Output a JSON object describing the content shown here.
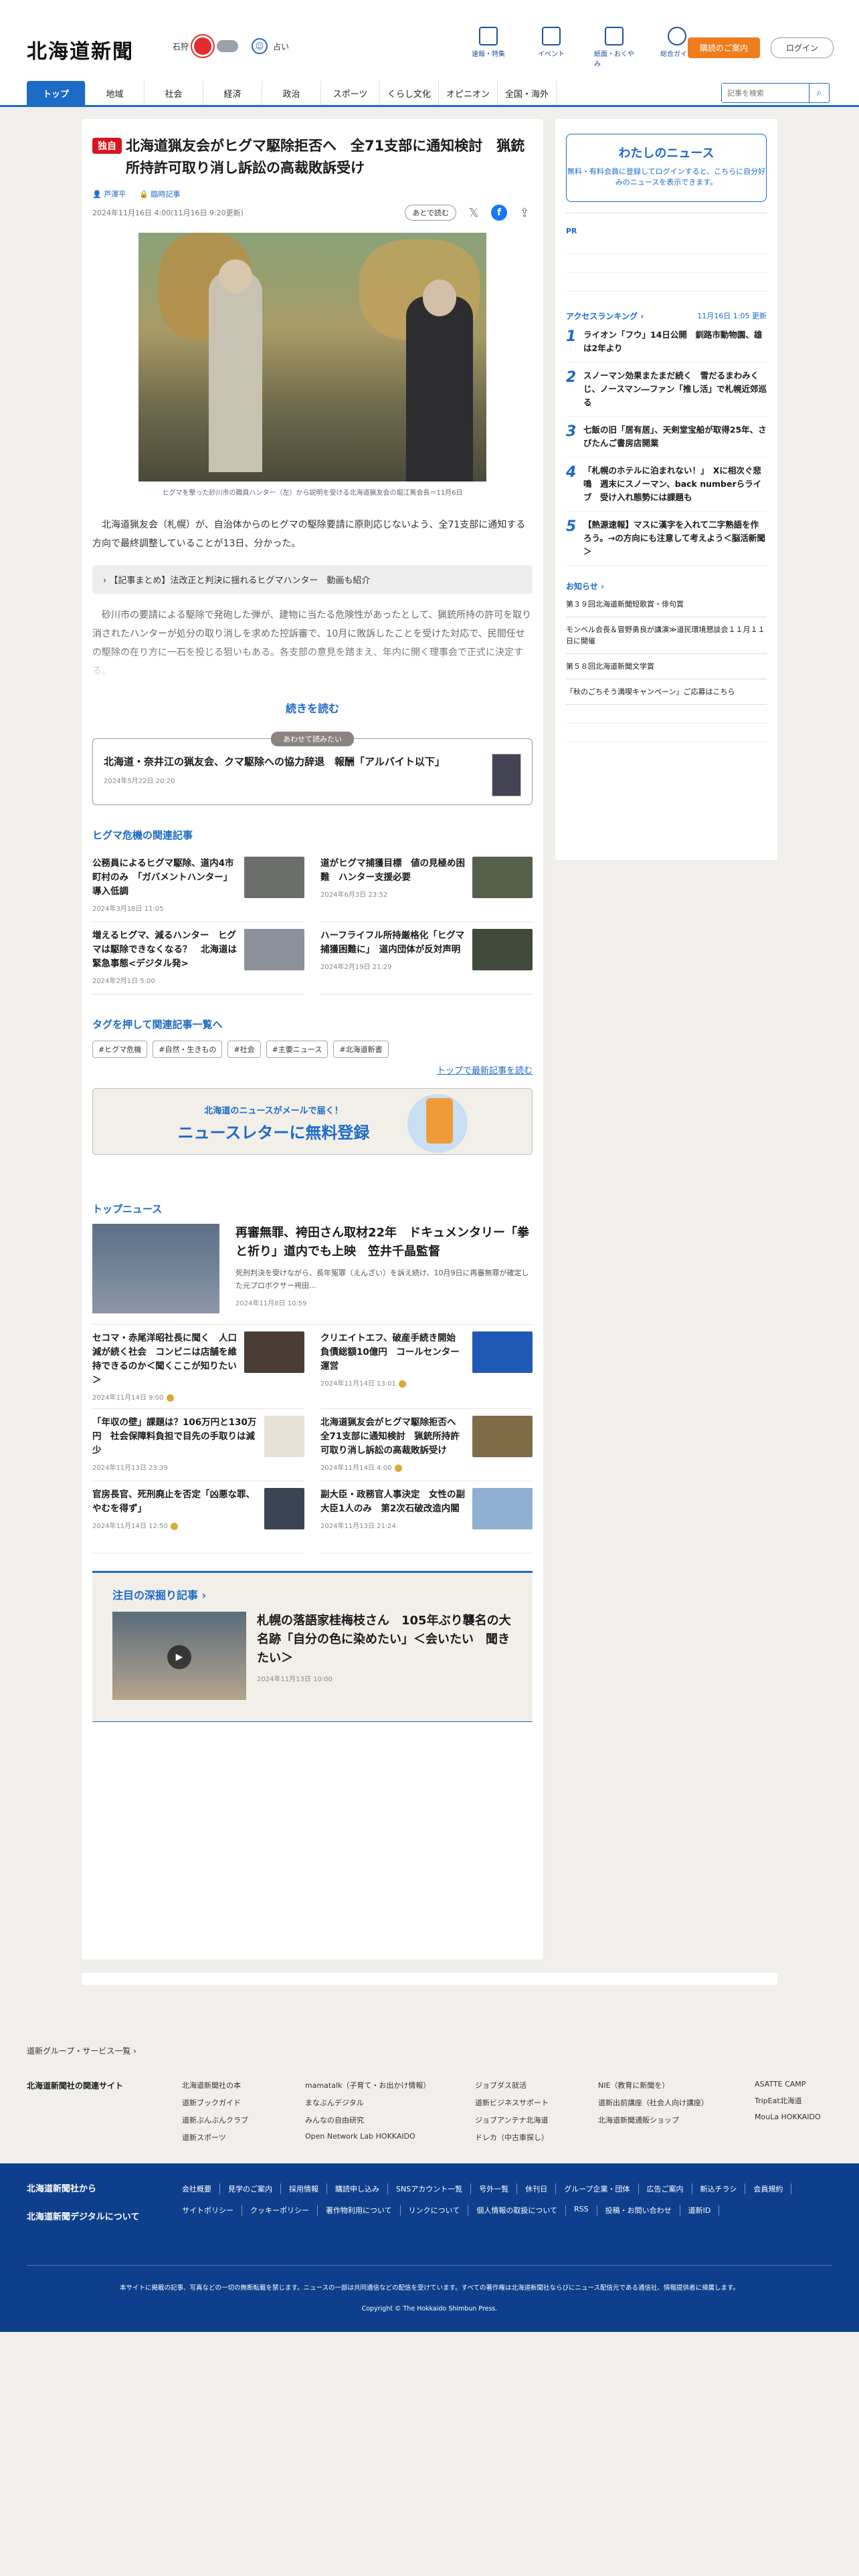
{
  "header": {
    "logo": "北海道新聞",
    "weather_region": "石狩",
    "weather_mood": "占い",
    "icons": [
      {
        "label": "速報・特集",
        "icon": "flag-icon"
      },
      {
        "label": "イベント",
        "icon": "calendar-icon"
      },
      {
        "label": "紙面・おくやみ",
        "icon": "newspaper-icon"
      },
      {
        "label": "総合ガイド",
        "icon": "help-icon"
      }
    ],
    "buy_label": "購読のご案内",
    "login_label": "ログイン"
  },
  "nav": {
    "items": [
      "トップ",
      "地域",
      "社会",
      "経済",
      "政治",
      "スポーツ",
      "くらし文化",
      "オピニオン",
      "全国・海外"
    ],
    "search_placeholder": "記事を検索"
  },
  "article": {
    "badge": "独自",
    "title": "北海道猟友会がヒグマ駆除拒否へ　全71支部に通知検討　猟銃所持許可取り消し訴訟の高裁敗訴受け",
    "author": "芦澤平",
    "category": "臨時記事",
    "date": "2024年11月16日 4:00(11月16日 9:20更新)",
    "save_label": "あとで読む",
    "caption": "ヒグマを撃った砂川市の職員ハンター（左）から説明を受ける北海道猟友会の堀江篤会長＝11月6日",
    "lead": "北海道猟友会（札幌）が、自治体からのヒグマの駆除要請に原則応じないよう、全71支部に通知する方向で最終調整していることが13日、分かった。",
    "related_box": "【記事まとめ】法改正と判決に揺れるヒグマハンター　動画も紹介",
    "body": "砂川市の要請による駆除で発砲した弾が、建物に当たる危険性があったとして、猟銃所持の許可を取り消されたハンターが処分の取り消しを求めた控訴審で、10月に敗訴したことを受けた対応で、民間任せの駆除の在り方に一石を投じる狙いもある。各支部の意見を踏まえ、年内に開く理事会で正式に決定する。",
    "read_more": "続きを読む"
  },
  "also_read": {
    "tag": "あわせて読みたい",
    "title": "北海道・奈井江の猟友会、クマ駆除への協力辞退　報酬「アルバイト以下」",
    "date": "2024年5月22日 20:20"
  },
  "related": {
    "title": "ヒグマ危機の関連記事",
    "items": [
      {
        "title": "公務員によるヒグマ駆除、道内4市町村のみ　「ガバメントハンター」導入低調",
        "date": "2024年3月18日 11:05"
      },
      {
        "title": "道がヒグマ捕獲目標　値の見極め困難　ハンター支援必要",
        "date": "2024年6月3日 23:52"
      },
      {
        "title": "増えるヒグマ、減るハンター　ヒグマは駆除できなくなる？　北海道は緊急事態<デジタル発>",
        "date": "2024年2月1日 5:00"
      },
      {
        "title": "ハーフライフル所持厳格化「ヒグマ捕獲困難に」　道内団体が反対声明",
        "date": "2024年2月19日 21:29"
      }
    ]
  },
  "tags": {
    "title": "タグを押して関連記事一覧へ",
    "items": [
      "#ヒグマ危機",
      "#自然・生きもの",
      "#社会",
      "#主要ニュース",
      "#北海道新書"
    ],
    "more": "トップで最新記事を読む"
  },
  "newsletter": {
    "sub": "北海道のニュースがメールで届く！",
    "main": "ニュースレターに無料登録"
  },
  "top_news": {
    "title": "トップニュース",
    "feature": {
      "title": "再審無罪、袴田さん取材22年　ドキュメンタリー「拳と祈り」道内でも上映　笠井千晶監督",
      "summary": "死刑判決を受けながら、長年冤罪（えんざい）を訴え続け、10月9日に再審無罪が確定した元プロボクサー袴田...",
      "date": "2024年11月8日 10:59"
    },
    "items": [
      {
        "title": "セコマ・赤尾洋昭社長に聞く　人口減が続く社会　コンビニは店舗を維持できるのか＜聞くここが知りたい＞",
        "date": "2024年11月14日 9:00"
      },
      {
        "title": "クリエイトエフ、破産手続き開始　負債総額10億円　コールセンター運営",
        "date": "2024年11月14日 13:01"
      },
      {
        "title": "「年収の壁」課題は？106万円と130万円　社会保障料負担で目先の手取りは減少",
        "date": "2024年11月13日 23:39"
      },
      {
        "title": "北海道猟友会がヒグマ駆除拒否へ　全71支部に通知検討　猟銃所持許可取り消し訴訟の高裁敗訴受け",
        "date": "2024年11月14日 4:00"
      },
      {
        "title": "官房長官、死刑廃止を否定「凶悪な罪、やむを得ず」",
        "date": "2024年11月14日 12:50"
      },
      {
        "title": "副大臣・政務官人事決定　女性の副大臣1人のみ　第2次石破改造内閣",
        "date": "2024年11月13日 21:24"
      }
    ]
  },
  "pickup": {
    "title": "注目の深掘り記事",
    "headline": "札幌の落語家桂梅枝さん　105年ぶり襲名の大名跡「自分の色に染めたい」＜会いたい　聞きたい＞",
    "date": "2024年11月13日 10:00"
  },
  "sidebar": {
    "my_news_title": "わたしのニュース",
    "my_news_text": "無料・有料会員に登録してログインすると、こちらに自分好みのニュースを表示できます。",
    "pr": "PR",
    "ranking_title": "アクセスランキング",
    "ranking_time": "11月16日 1:05 更新",
    "ranking": [
      {
        "n": "1",
        "title": "ライオン「フウ」14日公開　釧路市動物園、雄は2年より"
      },
      {
        "n": "2",
        "title": "スノーマン効果またまだ続く　雪だるまわみくじ、ノースマン―ファン「推し活」で札幌近郊巡る"
      },
      {
        "n": "3",
        "title": "七飯の旧「居有居」、天剣堂宝船が取得25年、さびたんご書房店開業"
      },
      {
        "n": "4",
        "title": "「札幌のホテルに泊まれない！」　Xに相次ぐ悲鳴　週末にスノーマン、back numberらライブ　受け入れ態勢には課題も"
      },
      {
        "n": "5",
        "title": "【熱源速報】マスに漢字を入れて二字熟語を作ろう。→の方向にも注意して考えよう＜脳活新聞＞"
      }
    ],
    "notice_title": "お知らせ",
    "notices": [
      "第３９回北海道新聞短歌賞・俳句賞",
      "モンベル会長＆冒野勇良が講演≫道民環境懇談会１１月１１日に開催",
      "第５８回北海道新聞文学賞",
      "「秋のごちそう満喫キャンペーン」ご応募はこちら"
    ]
  },
  "footer": {
    "group_link": "道新グループ・サービス一覧",
    "related_label": "北海道新聞社の関連サイト",
    "related_cols": [
      [
        "北海道新聞社の本",
        "道新ブックガイド",
        "道新ぶんぶんクラブ",
        "道新スポーツ"
      ],
      [
        "mamatalk（子育て・お出かけ情報）",
        "まなぶんデジタル",
        "みんなの自由研究",
        "Open Network Lab HOKKAIDO"
      ],
      [
        "ジョブダス就活",
        "道新ビジネスサポート",
        "ジョブアンテナ北海道",
        "ドレカ（中古車探し）"
      ],
      [
        "NIE（教育に新聞を）",
        "道新出前講座（社会人向け講座）",
        "北海道新聞通販ショップ"
      ],
      [
        "ASATTE CAMP",
        "TripEat北海道",
        "MouLa HOKKAIDO"
      ]
    ],
    "blue_left": [
      "北海道新聞社から",
      "北海道新聞デジタルについて"
    ],
    "links": [
      "会社概要",
      "見学のご案内",
      "採用情報",
      "購読申し込み",
      "SNSアカウント一覧",
      "号外一覧",
      "休刊日",
      "グループ企業・団体",
      "広告ご案内",
      "新込チラシ",
      "会員規約",
      "サイトポリシー",
      "クッキーポリシー",
      "著作物利用について",
      "リンクについて",
      "個人情報の取扱について",
      "RSS",
      "投稿・お問い合わせ",
      "道新ID"
    ],
    "note": "本サイトに掲載の記事、写真などの一切の無断転載を禁じます。ニュースの一部は共同通信などの配信を受けています。すべての著作権は北海道新聞社ならびにニュース配信元である通信社、情報提供者に帰属します。",
    "copyright": "Copyright © The Hokkaido Shimbun Press."
  },
  "colors": {
    "brand": "#1c6bc6",
    "exclusive": "#d8141f",
    "buy": "#ef7d1e",
    "footer": "#0e3f8c"
  }
}
